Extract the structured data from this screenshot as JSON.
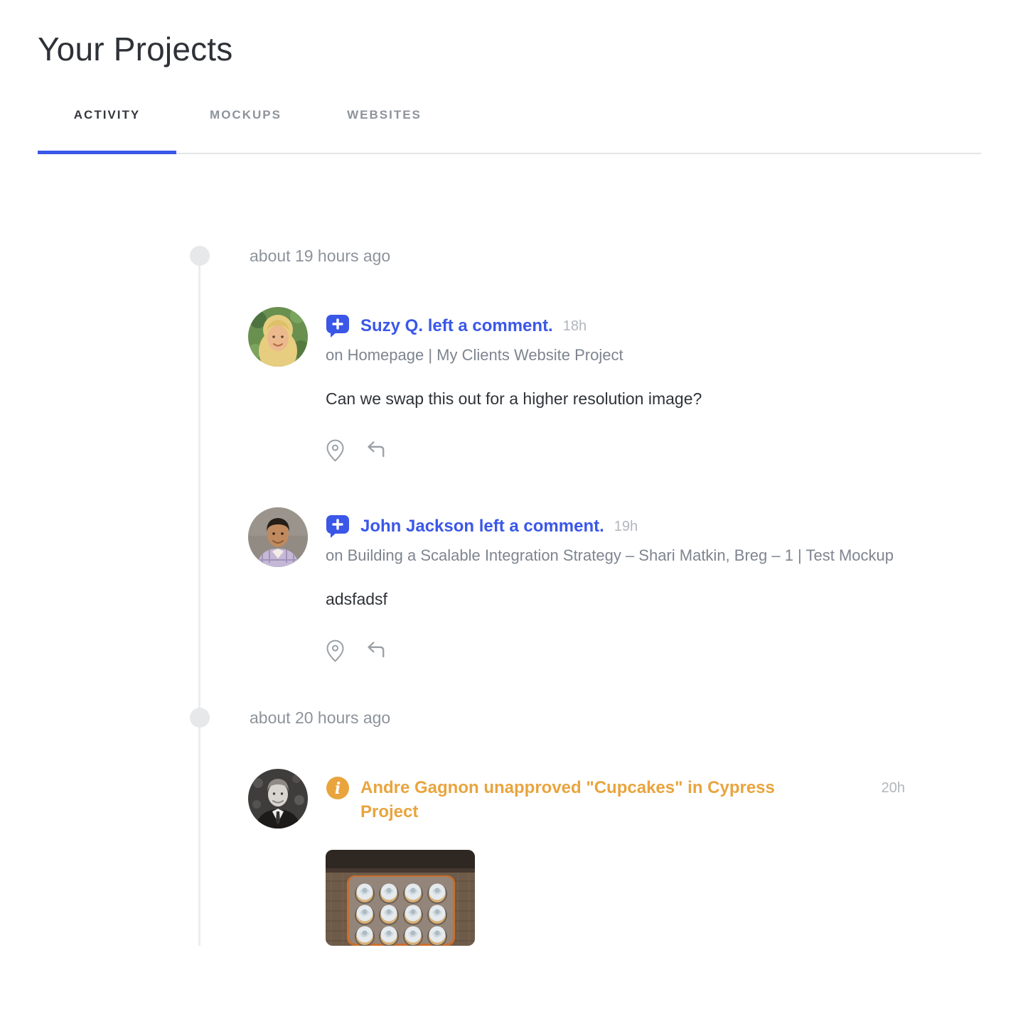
{
  "page": {
    "title": "Your Projects"
  },
  "tabs": [
    {
      "label": "ACTIVITY",
      "active": true
    },
    {
      "label": "MOCKUPS",
      "active": false
    },
    {
      "label": "WEBSITES",
      "active": false
    }
  ],
  "colors": {
    "accent_blue": "#3a57e8",
    "accent_orange": "#e9a43e",
    "muted_text": "#7e8590",
    "timestamp_text": "#b2b6bc"
  },
  "icons": {
    "comment_event": "comment-plus-icon",
    "status_event": "info-icon",
    "actions": [
      "location-pin-icon",
      "reply-icon"
    ]
  },
  "timeline": {
    "groups": [
      {
        "label": "about 19 hours ago",
        "events": [
          {
            "title": "Suzy Q. left a comment.",
            "time": "18h",
            "context": "on Homepage | My Clients Website Project",
            "body": "Can we swap this out for a higher resolution image?"
          },
          {
            "title": "John Jackson left a comment.",
            "time": "19h",
            "context": "on Building a Scalable Integration Strategy – Shari Matkin, Breg – 1 | Test Mockup",
            "body": "adsfadsf"
          }
        ]
      },
      {
        "label": "about 20 hours ago",
        "events": [
          {
            "title": "Andre Gagnon unapproved \"Cupcakes\" in Cypress Project",
            "time": "20h",
            "image": "cupcakes-in-muffin-tray"
          }
        ]
      }
    ]
  }
}
